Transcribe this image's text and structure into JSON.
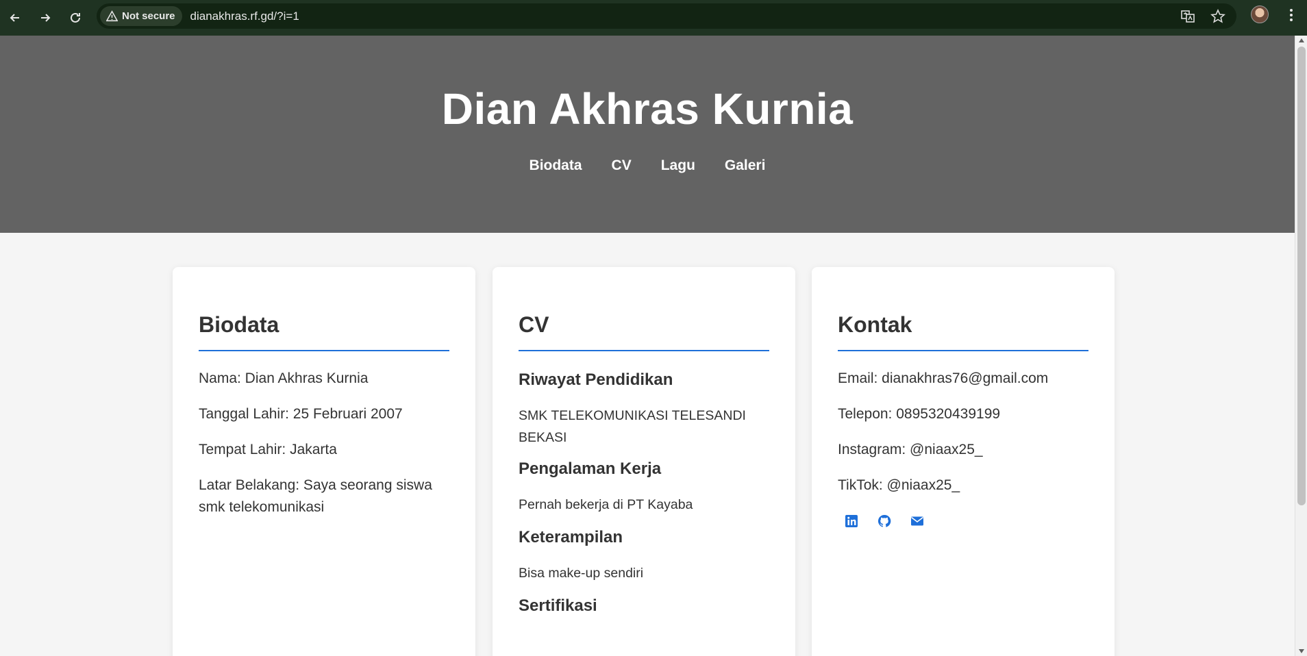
{
  "browser": {
    "security_label": "Not secure",
    "url": "dianakhras.rf.gd/?i=1"
  },
  "header": {
    "title": "Dian Akhras Kurnia",
    "nav": [
      "Biodata",
      "CV",
      "Lagu",
      "Galeri"
    ]
  },
  "biodata": {
    "heading": "Biodata",
    "lines": [
      "Nama: Dian Akhras Kurnia",
      "Tanggal Lahir: 25 Februari 2007",
      "Tempat Lahir: Jakarta",
      "Latar Belakang: Saya seorang siswa smk telekomunikasi"
    ]
  },
  "cv": {
    "heading": "CV",
    "sections": [
      {
        "title": "Riwayat Pendidikan",
        "text": "SMK TELEKOMUNIKASI TELESANDI BEKASI"
      },
      {
        "title": "Pengalaman Kerja",
        "text": "Pernah bekerja di PT Kayaba"
      },
      {
        "title": "Keterampilan",
        "text": "Bisa make-up sendiri"
      },
      {
        "title": "Sertifikasi",
        "text": ""
      }
    ]
  },
  "kontak": {
    "heading": "Kontak",
    "lines": [
      "Email: dianakhras76@gmail.com",
      "Telepon: 0895320439199",
      "Instagram: @niaax25_",
      "TikTok: @niaax25_"
    ],
    "social_icons": [
      "linkedin-icon",
      "github-icon",
      "envelope-icon"
    ]
  },
  "colors": {
    "accent": "#1e6fd9",
    "hero_bg": "#636363",
    "chrome_bg": "#1f3322"
  }
}
